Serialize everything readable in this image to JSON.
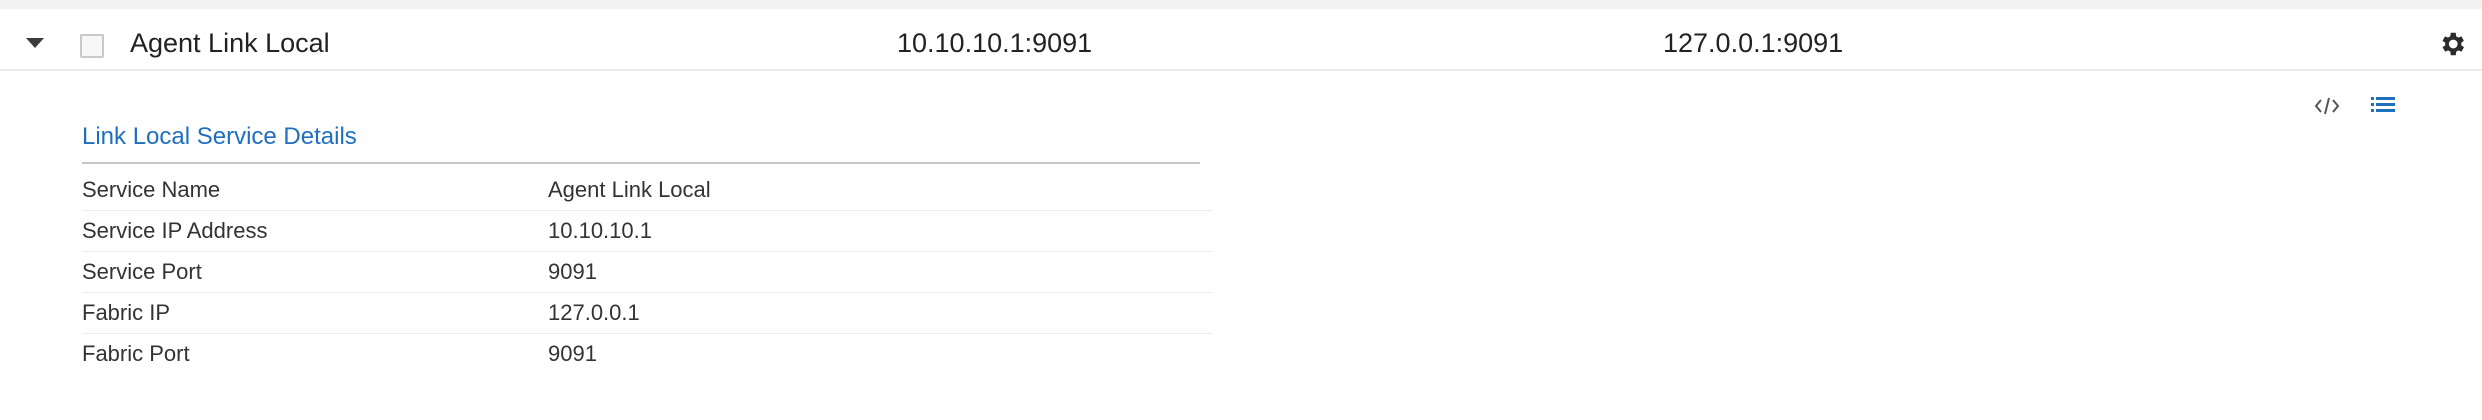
{
  "row": {
    "name": "Agent Link Local",
    "service_address": "10.10.10.1:9091",
    "fabric_address": "127.0.0.1:9091"
  },
  "icons": {
    "expand": "caret-down-icon",
    "select": "checkbox-icon",
    "settings": "gear-icon",
    "code_view": "code-icon",
    "list_view": "list-icon"
  },
  "colors": {
    "title": "#1f6fbf",
    "list_icon": "#1f6fbf",
    "text": "#222222"
  },
  "details": {
    "title": "Link Local Service Details",
    "rows": [
      {
        "key": "Service Name",
        "value": "Agent Link Local"
      },
      {
        "key": "Service IP Address",
        "value": "10.10.10.1"
      },
      {
        "key": "Service Port",
        "value": "9091"
      },
      {
        "key": "Fabric IP",
        "value": "127.0.0.1"
      },
      {
        "key": "Fabric Port",
        "value": "9091"
      }
    ]
  }
}
